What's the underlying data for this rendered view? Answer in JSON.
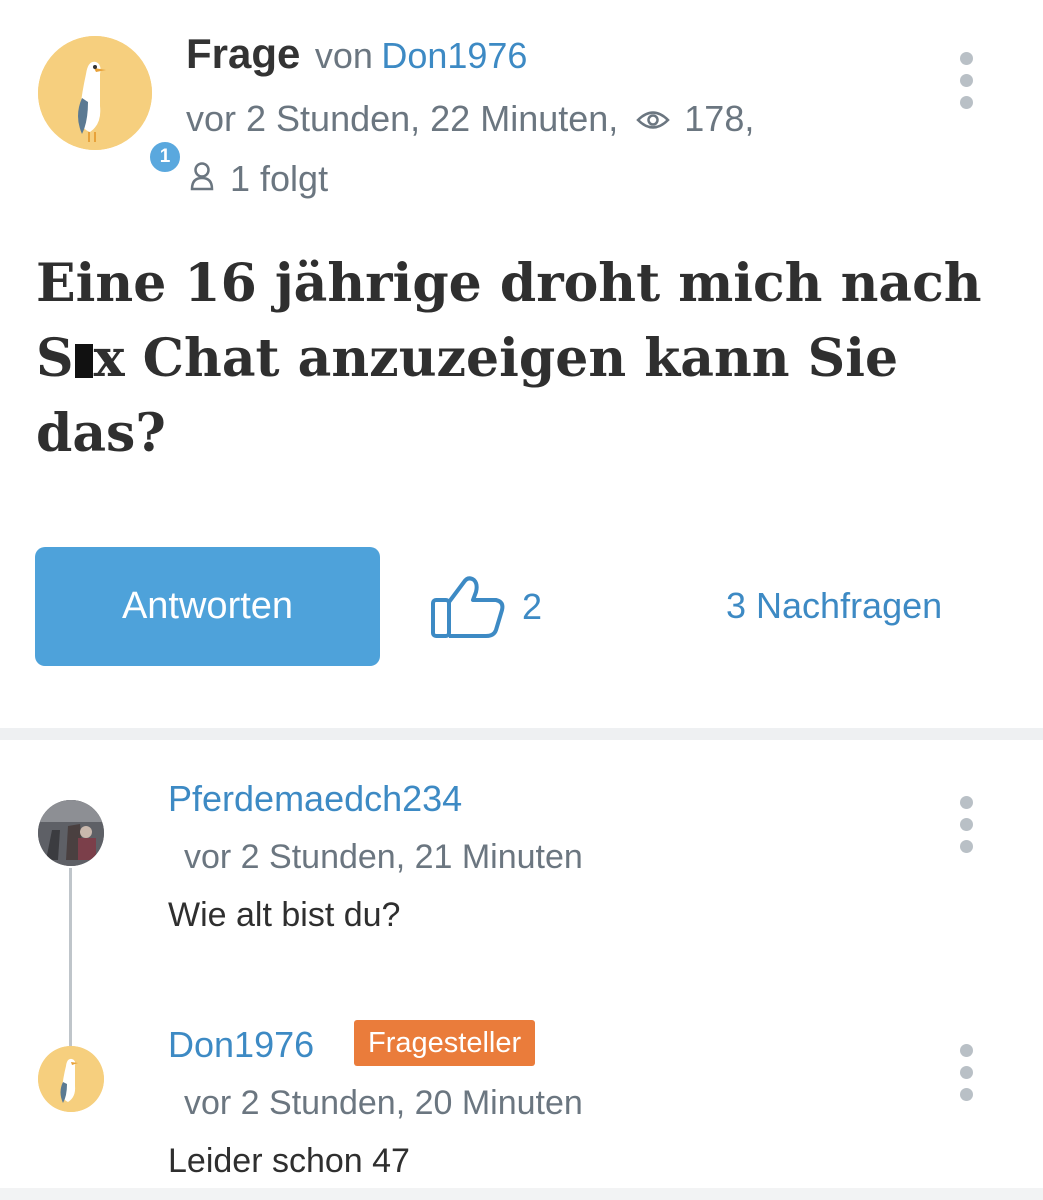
{
  "question": {
    "type_label": "Frage",
    "by_label": "von",
    "author": "Don1976",
    "author_level": "1",
    "time": "vor 2 Stunden, 22 Minuten,",
    "views": "178,",
    "follows": "1 folgt",
    "title_parts": {
      "line1": "Eine 16 jährige droht mich nach",
      "line2_start": "S",
      "line2_end": "x Chat anzuzeigen kann Sie",
      "line3": "das?"
    },
    "answer_button": "Antworten",
    "likes": "2",
    "followups": "3 Nachfragen"
  },
  "comments": [
    {
      "author": "Pferdemaedch234",
      "time": "vor 2 Stunden, 21 Minuten",
      "text": "Wie alt bist du?"
    },
    {
      "author": "Don1976",
      "badge": "Fragesteller",
      "time": "vor 2 Stunden, 20 Minuten",
      "text": "Leider schon 47"
    }
  ],
  "colors": {
    "accent": "#3d8ac4",
    "button": "#4ea2da",
    "asker_badge": "#ea7c3b",
    "avatar_bg": "#f6cf7e"
  },
  "icons": [
    "seagull-avatar",
    "level-badge",
    "eye-icon",
    "person-icon",
    "thumbs-up-icon",
    "more-vertical-icon"
  ]
}
